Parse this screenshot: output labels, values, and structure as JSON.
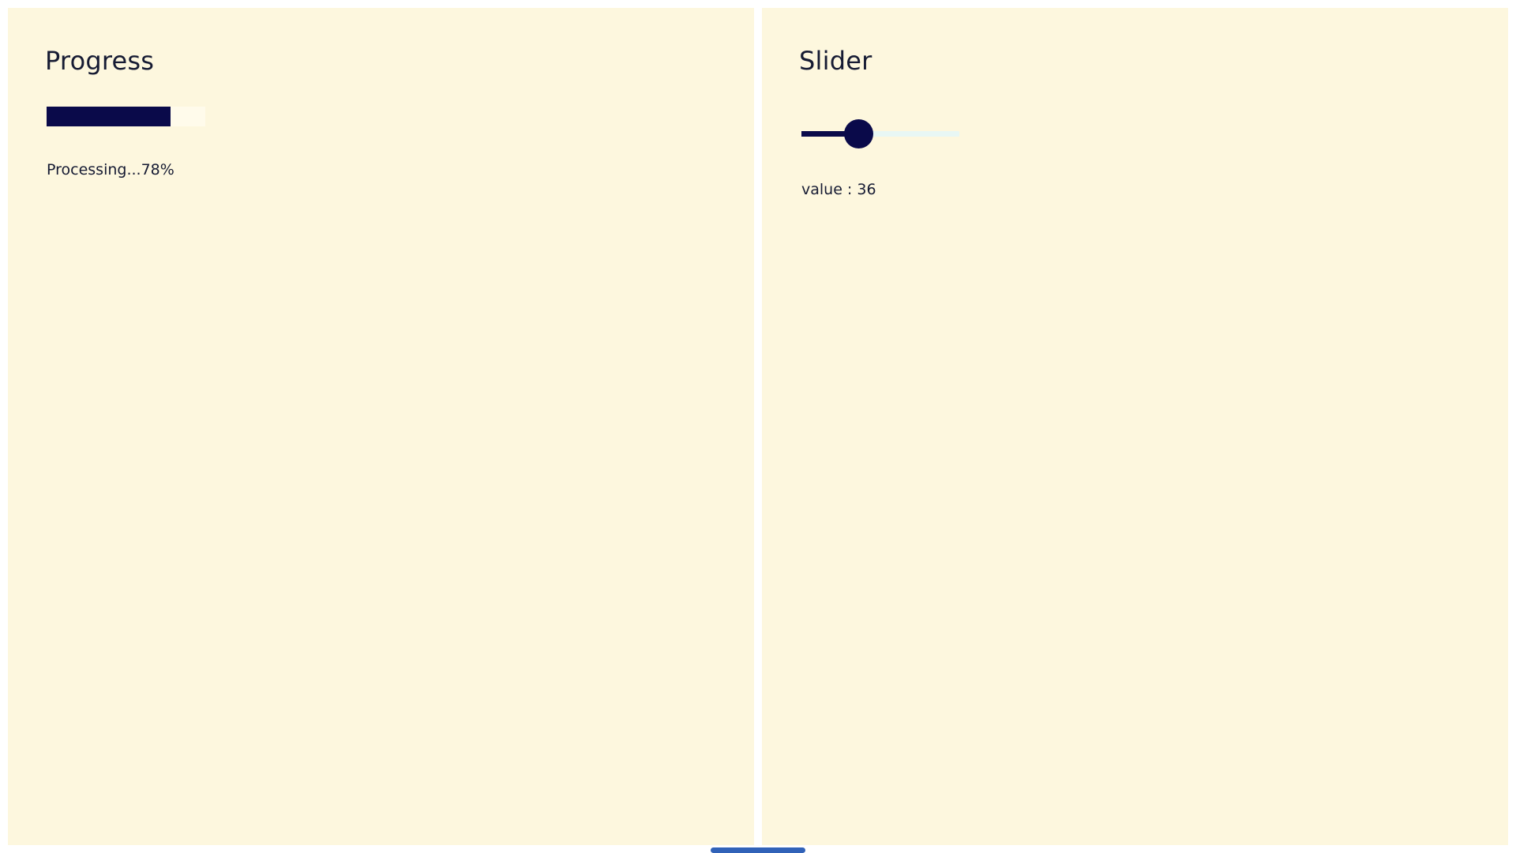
{
  "colors": {
    "panel_background": "#fdf7de",
    "accent": "#0a0a4a",
    "progress_track": "#fffbeb",
    "slider_rail": "#e8f7f4",
    "scroll_indicator": "#3162b8"
  },
  "progress_panel": {
    "title": "Progress",
    "percent": 78,
    "status_text": "Processing...78%"
  },
  "slider_panel": {
    "title": "Slider",
    "value": 36,
    "min": 0,
    "max": 100,
    "value_text": "value : 36"
  }
}
